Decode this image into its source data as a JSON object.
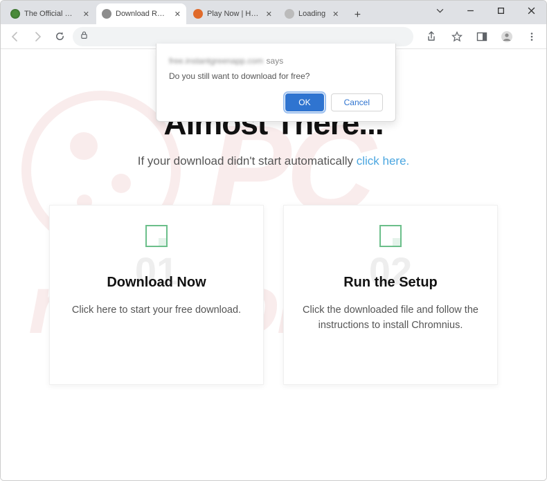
{
  "tabs": [
    {
      "title": "The Official Home of"
    },
    {
      "title": "Download Ready"
    },
    {
      "title": "Play Now | Hero Wars"
    },
    {
      "title": "Loading"
    }
  ],
  "dialog": {
    "origin": "free.instantgreenapp.com",
    "says": "says",
    "message": "Do you still want to download for free?",
    "ok": "OK",
    "cancel": "Cancel"
  },
  "page": {
    "heading": "Almost There...",
    "subtext": "If your download didn't start automatically ",
    "sublink": "click here.",
    "card1": {
      "num": "01",
      "title": "Download Now",
      "body": "Click here to start your free download."
    },
    "card2": {
      "num": "02",
      "title": "Run the Setup",
      "body": "Click the downloaded file and follow the instructions to install Chromnius."
    }
  },
  "watermark": {
    "line1": "PC",
    "line2": "risk.com"
  }
}
